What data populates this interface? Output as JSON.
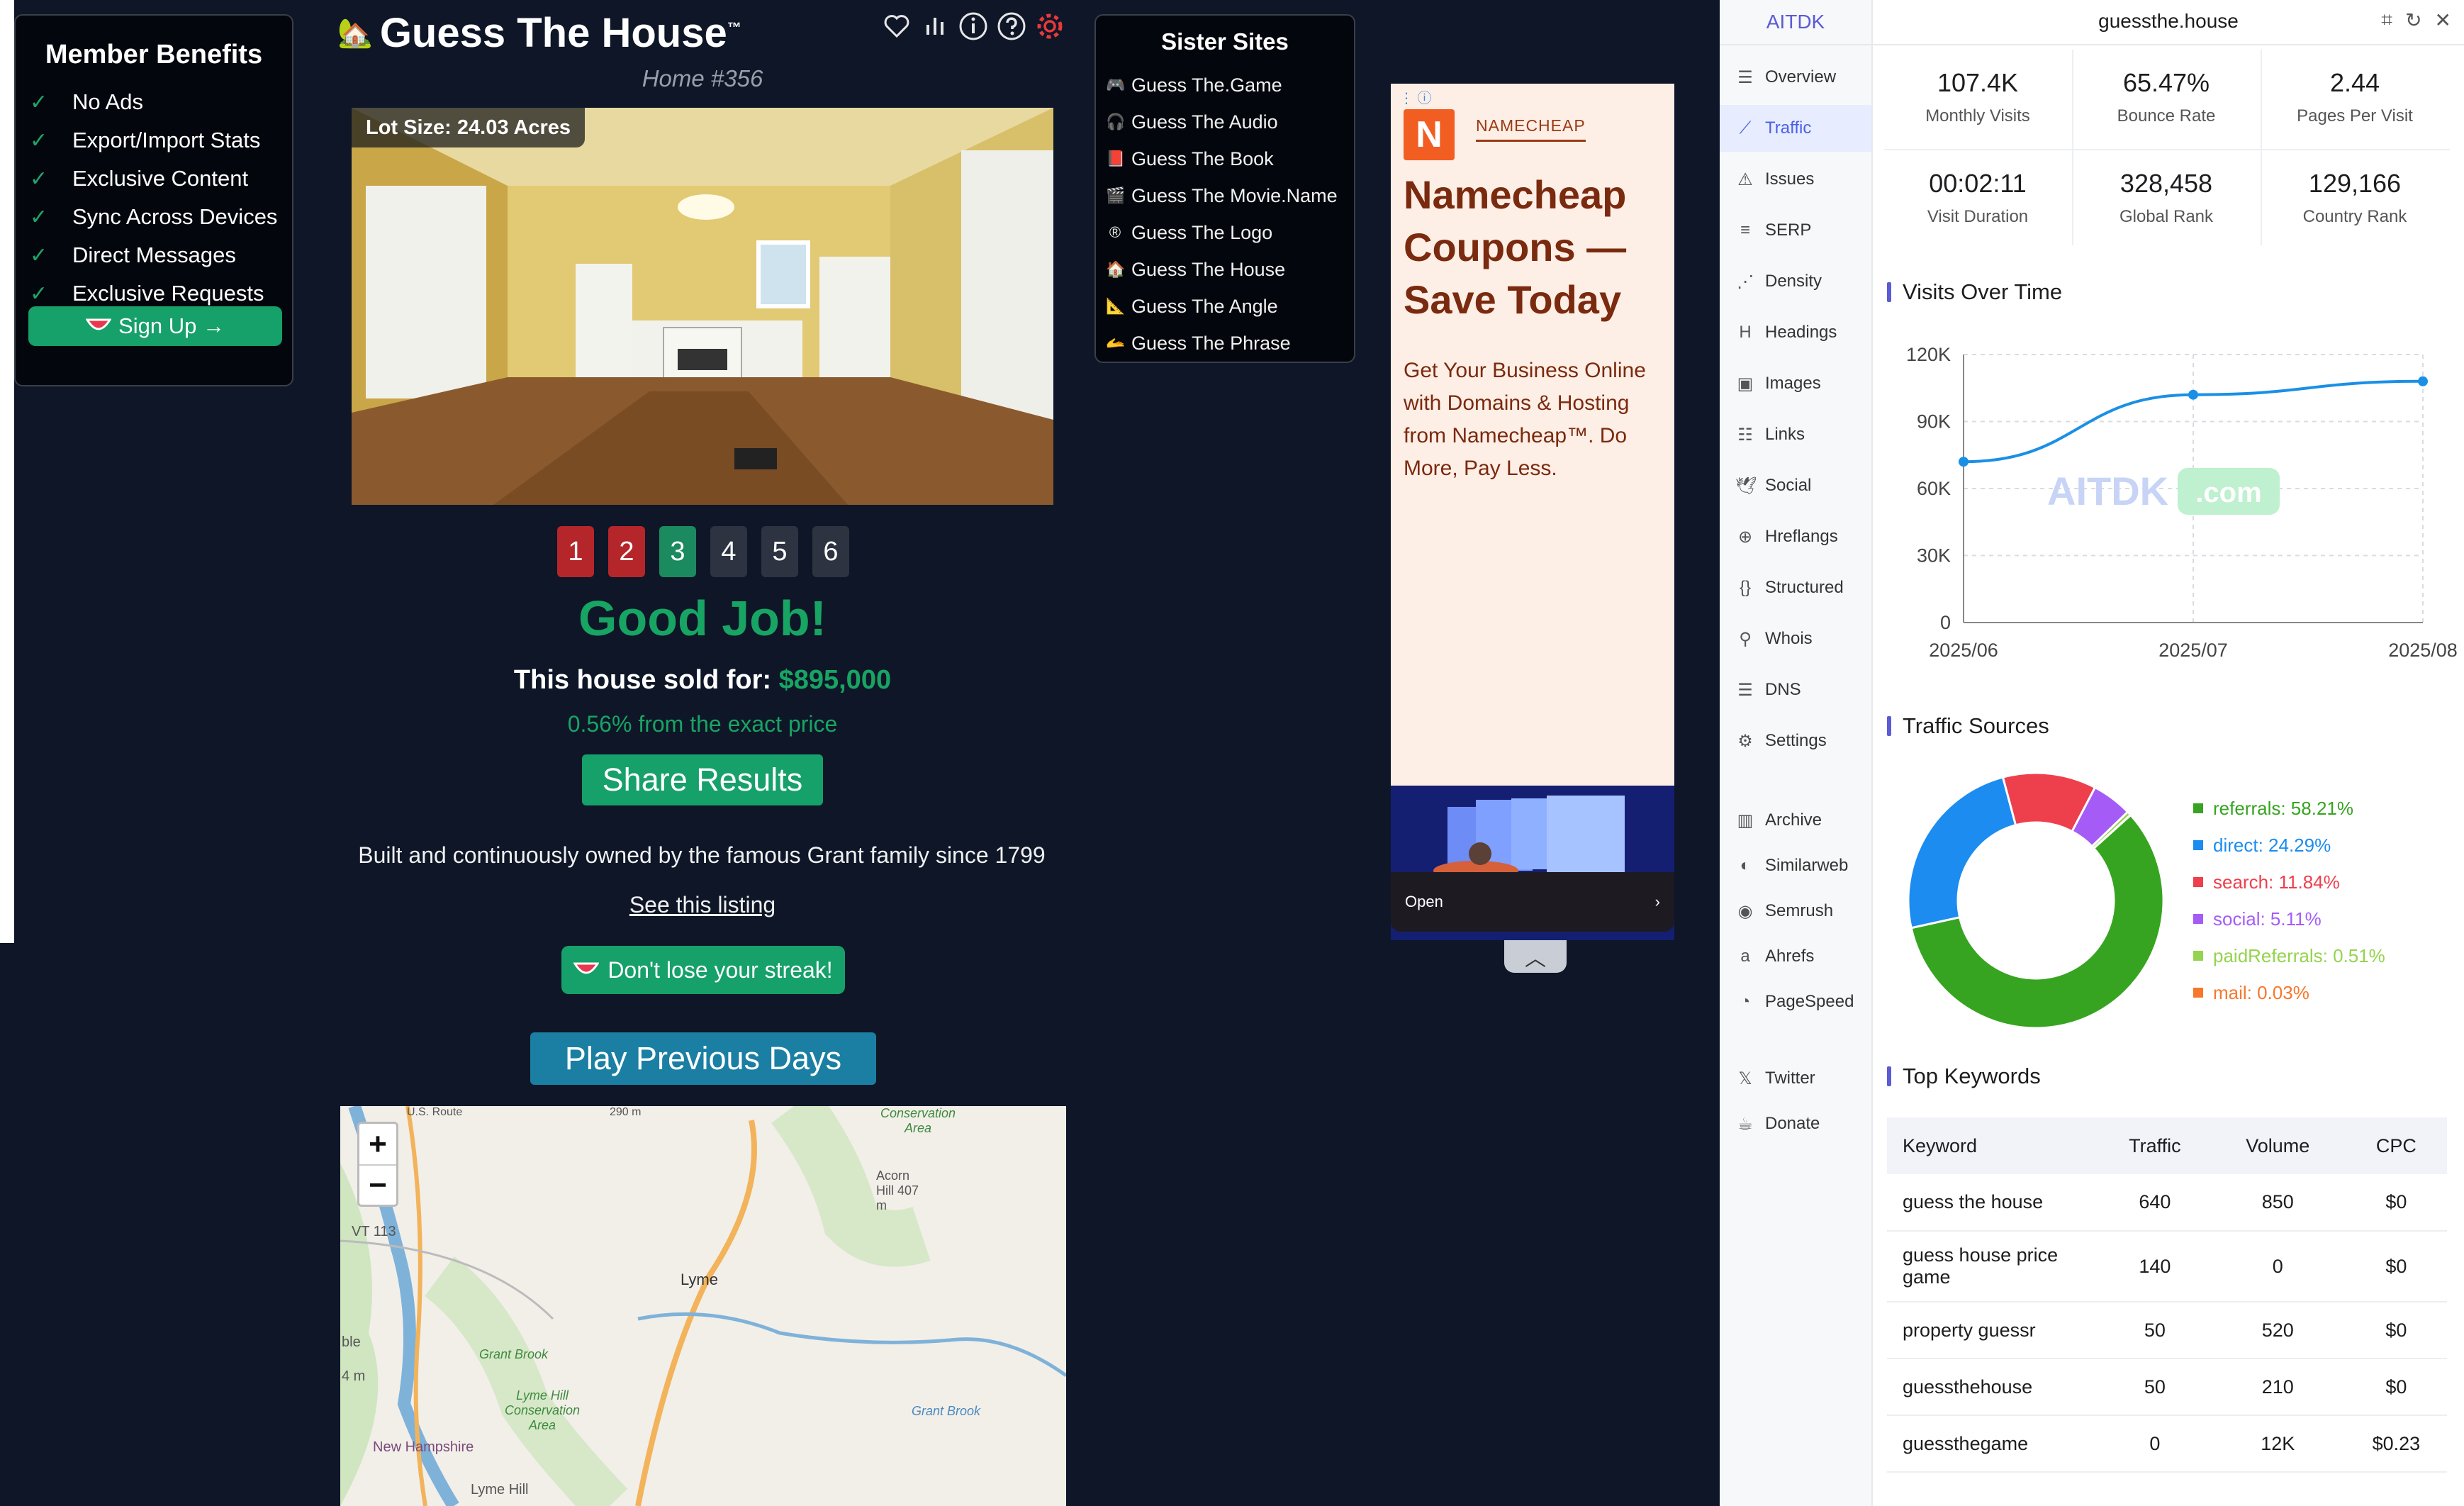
{
  "member_benefits": {
    "title": "Member Benefits",
    "items": [
      "No Ads",
      "Export/Import Stats",
      "Exclusive Content",
      "Sync Across Devices",
      "Direct Messages",
      "Exclusive Requests"
    ],
    "signup_label": "Sign Up →"
  },
  "game": {
    "title": "Guess The House",
    "trademark": "™",
    "home_number": "Home #356",
    "lot_size": "Lot Size: 24.03 Acres",
    "guesses": [
      {
        "label": "1",
        "status": "wrong"
      },
      {
        "label": "2",
        "status": "wrong"
      },
      {
        "label": "3",
        "status": "correct"
      },
      {
        "label": "4",
        "status": "unused"
      },
      {
        "label": "5",
        "status": "unused"
      },
      {
        "label": "6",
        "status": "unused"
      }
    ],
    "result_heading": "Good Job!",
    "sold_prefix": "This house sold for: ",
    "sold_price": "$895,000",
    "difference": "0.56% from the exact price",
    "share_label": "Share Results",
    "description": "Built and continuously owned by the famous Grant family since 1799",
    "listing_link": "See this listing",
    "streak_label": "Don't lose your streak!",
    "previous_days_label": "Play Previous Days"
  },
  "map": {
    "zoom_in": "+",
    "zoom_out": "−",
    "labels": {
      "town": "Lyme",
      "route": "VT 113",
      "conservation_top": "Conservation Area",
      "hill": "Acorn Hill 407 m",
      "lyme_hill_cons": "Lyme Hill Conservation Area",
      "grant_brook": "Grant Brook",
      "grant_brook_2": "Grant Brook",
      "state": "New Hampshire",
      "lyme_hill": "Lyme Hill",
      "us_route": "U.S. Route",
      "ble": "ble",
      "m4": "4 m",
      "top_num": "290 m"
    }
  },
  "sister_sites": {
    "title": "Sister Sites",
    "items": [
      {
        "icon": "🎮",
        "label": "Guess The.Game"
      },
      {
        "icon": "🎧",
        "label": "Guess The Audio"
      },
      {
        "icon": "📕",
        "label": "Guess The Book"
      },
      {
        "icon": "🎬",
        "label": "Guess The Movie.Name"
      },
      {
        "icon": "®",
        "label": "Guess The Logo"
      },
      {
        "icon": "🏠",
        "label": "Guess The House"
      },
      {
        "icon": "📐",
        "label": "Guess The Angle"
      },
      {
        "icon": "🫴",
        "label": "Guess The Phrase"
      }
    ]
  },
  "ad": {
    "brand": "NAMECHEAP",
    "headline": "Namecheap Coupons — Save Today",
    "body": "Get Your Business Online with Domains & Hosting from Namecheap™. Do More, Pay Less.",
    "open_label": "Open"
  },
  "aitdk": {
    "logo": "AITDK",
    "domain": "guessthe.house",
    "nav": [
      "Overview",
      "Traffic",
      "Issues",
      "SERP",
      "Density",
      "Headings",
      "Images",
      "Links",
      "Social",
      "Hreflangs",
      "Structured",
      "Whois",
      "DNS",
      "Settings",
      "Archive",
      "Similarweb",
      "Semrush",
      "Ahrefs",
      "PageSpeed",
      "Twitter",
      "Donate"
    ],
    "stats": [
      {
        "value": "107.4K",
        "label": "Monthly Visits"
      },
      {
        "value": "65.47%",
        "label": "Bounce Rate"
      },
      {
        "value": "2.44",
        "label": "Pages Per Visit"
      },
      {
        "value": "00:02:11",
        "label": "Visit Duration"
      },
      {
        "value": "328,458",
        "label": "Global Rank"
      },
      {
        "value": "129,166",
        "label": "Country Rank"
      }
    ],
    "visits_title": "Visits Over Time",
    "watermark": "AITDK",
    "watermark_suffix": ".com",
    "traffic_title": "Traffic Sources",
    "keywords_title": "Top Keywords",
    "keywords_headers": [
      "Keyword",
      "Traffic",
      "Volume",
      "CPC"
    ],
    "keywords": [
      [
        "guess the house",
        "640",
        "850",
        "$0"
      ],
      [
        "guess house price game",
        "140",
        "0",
        "$0"
      ],
      [
        "property guessr",
        "50",
        "520",
        "$0"
      ],
      [
        "guessthehouse",
        "50",
        "210",
        "$0"
      ],
      [
        "guessthegame",
        "0",
        "12K",
        "$0.23"
      ]
    ]
  },
  "chart_data": [
    {
      "type": "line",
      "title": "Visits Over Time",
      "x": [
        "2025/06",
        "2025/07",
        "2025/08"
      ],
      "series": [
        {
          "values": [
            72000,
            102000,
            108000
          ]
        }
      ],
      "ylim": [
        0,
        120000
      ],
      "yticks": [
        "0",
        "30K",
        "60K",
        "90K",
        "120K"
      ],
      "color": "#1a8fe6",
      "grid": true
    },
    {
      "type": "pie",
      "title": "Traffic Sources",
      "legend_position": "right",
      "categories": [
        "referrals",
        "direct",
        "search",
        "social",
        "paidReferrals",
        "mail"
      ],
      "values": [
        58.21,
        24.29,
        11.84,
        5.11,
        0.51,
        0.03
      ],
      "legend_labels": [
        "referrals: 58.21%",
        "direct: 24.29%",
        "search: 11.84%",
        "social: 5.11%",
        "paidReferrals: 0.51%",
        "mail: 0.03%"
      ],
      "colors": [
        "#36a420",
        "#1c8cf0",
        "#ee3f4d",
        "#a55cf7",
        "#94d44e",
        "#f7772b"
      ]
    }
  ]
}
